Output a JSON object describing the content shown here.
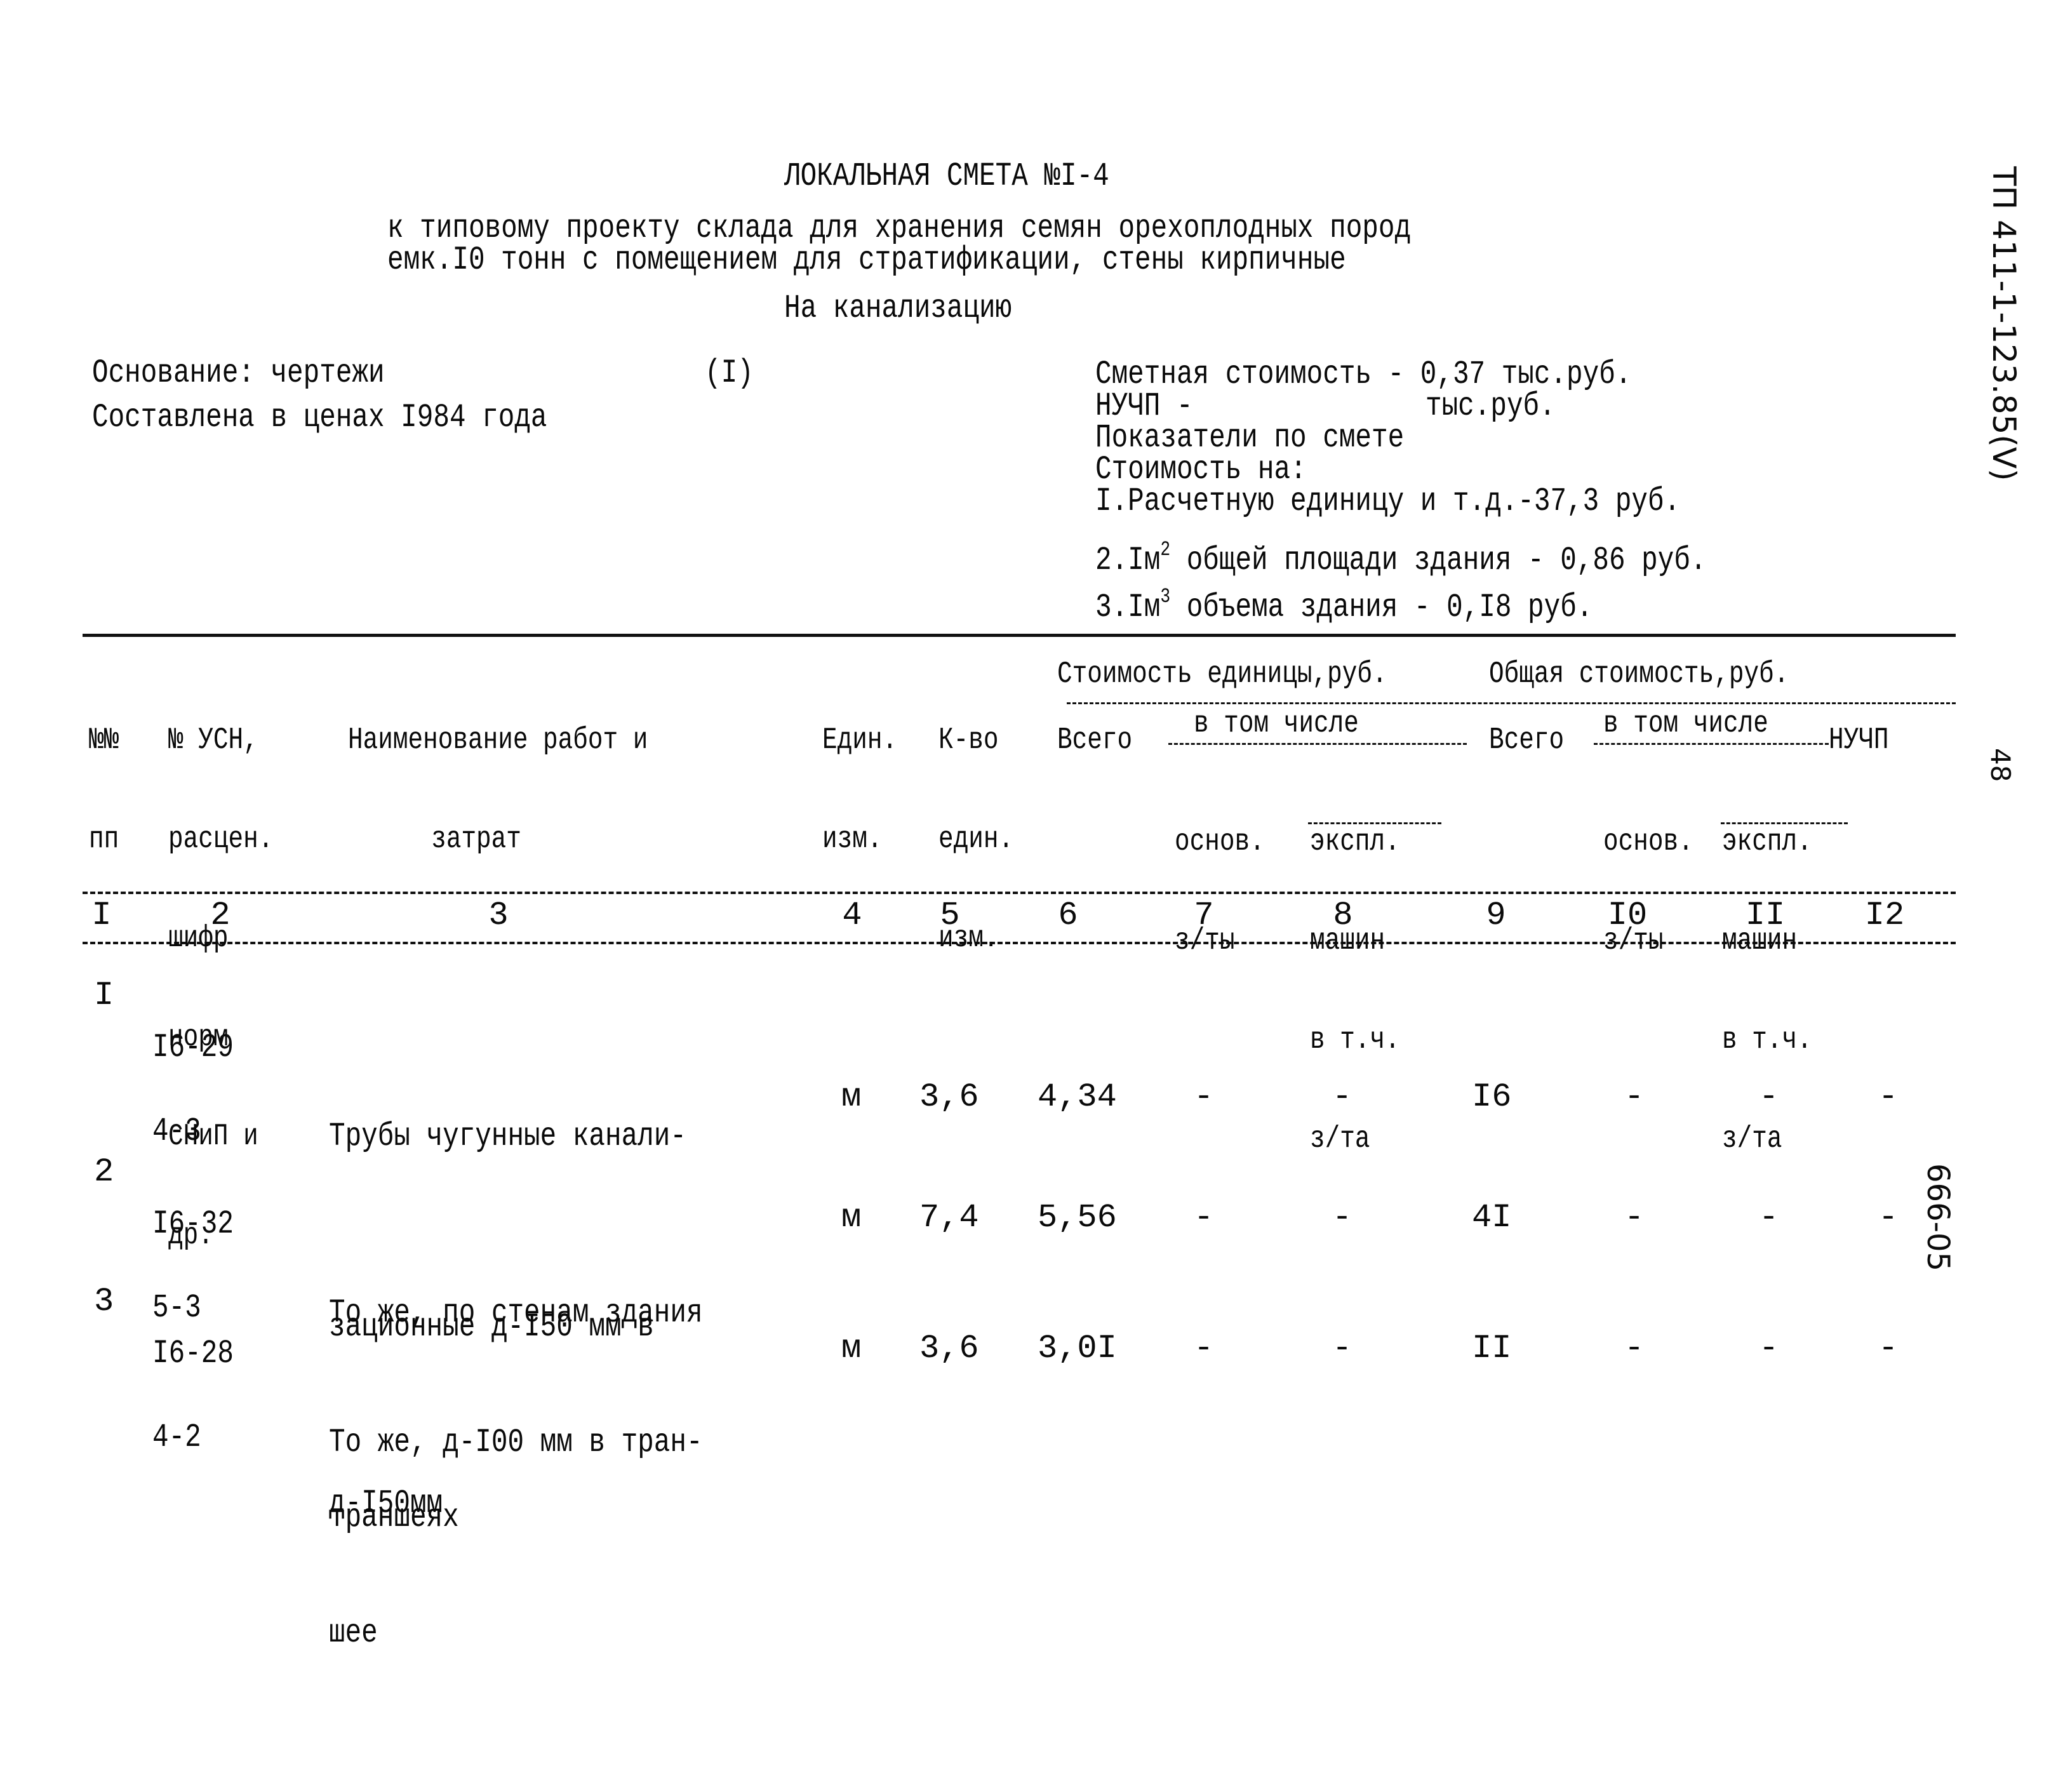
{
  "title": "ЛОКАЛЬНАЯ СМЕТА №I-4",
  "subtitle_line1": "к типовому проекту склада для хранения семян орехоплодных пород",
  "subtitle_line2": "емк.I0 тонн с помещением для стратификации, стены кирпичные",
  "section": "На канализацию",
  "basis": "Основание: чертежи",
  "basis_mark": "(I)",
  "prices": "Составлена в ценах I984 года",
  "summary": {
    "estimated_cost": "Сметная стоимость - 0,37 тыс.руб.",
    "nuchp_label": "НУЧП -",
    "nuchp_unit": "тыс.руб.",
    "indicators": "Показатели по смете",
    "cost_for": "Стоимость на:",
    "item1": "I.Расчетную единицу и т.д.-37,3 руб.",
    "item2_prefix": "2.Iм",
    "item2_sup": "2",
    "item2_suffix": " общей площади здания - 0,86 руб.",
    "item3_prefix": "3.Iм",
    "item3_sup": "3",
    "item3_suffix": " объема здания - 0,I8 руб."
  },
  "margin": {
    "doc_code": "ТП 411-1-123.85(V)",
    "page_number": "48",
    "stamp": "666-05"
  },
  "table": {
    "headers": {
      "c1": [
        "№№",
        "пп"
      ],
      "c2": [
        "№ УСН,",
        "расцен.",
        "шифр",
        "норм",
        "СНиП и",
        "др."
      ],
      "c3": [
        "Наименование работ и",
        "затрат"
      ],
      "c4": [
        "Един.",
        "изм."
      ],
      "c5": [
        "К-во",
        "един.",
        "изм."
      ],
      "unit_cost_group": "Стоимость единицы,руб.",
      "total_cost_group": "Общая стоимость,руб.",
      "total": "Всего",
      "incl": "в том числе",
      "base_wage": [
        "основ.",
        "з/ты"
      ],
      "base_wage_total": [
        "основ.",
        "з/ты"
      ],
      "machines": [
        "экспл.",
        "машин"
      ],
      "machines_incl": [
        "в т.ч.",
        "з/та"
      ],
      "nuchp": "НУЧП"
    },
    "column_numbers": [
      "I",
      "2",
      "3",
      "4",
      "5",
      "6",
      "7",
      "8",
      "9",
      "I0",
      "II",
      "I2"
    ],
    "rows": [
      {
        "num": "I",
        "code": [
          "I6-29",
          "4-3"
        ],
        "name": [
          "Трубы чугунные канали-",
          "зационные д-I50 мм в",
          "траншеях"
        ],
        "unit": "м",
        "qty": "3,6",
        "unit_total": "4,34",
        "unit_wage": "-",
        "unit_machines": "-",
        "total": "I6",
        "total_wage": "-",
        "total_machines": "-",
        "nuchp": "-"
      },
      {
        "num": "2",
        "code": [
          "I6-32",
          "5-3"
        ],
        "name": [
          "То же, по стенам здания",
          "д-I50мм"
        ],
        "unit": "м",
        "qty": "7,4",
        "unit_total": "5,56",
        "unit_wage": "-",
        "unit_machines": "-",
        "total": "4I",
        "total_wage": "-",
        "total_machines": "-",
        "nuchp": "-"
      },
      {
        "num": "3",
        "code": [
          "I6-28",
          "4-2"
        ],
        "name": [
          "То же, д-I00 мм в тран-",
          "шее"
        ],
        "unit": "м",
        "qty": "3,6",
        "unit_total": "3,0I",
        "unit_wage": "-",
        "unit_machines": "-",
        "total": "II",
        "total_wage": "-",
        "total_machines": "-",
        "nuchp": "-"
      }
    ]
  }
}
